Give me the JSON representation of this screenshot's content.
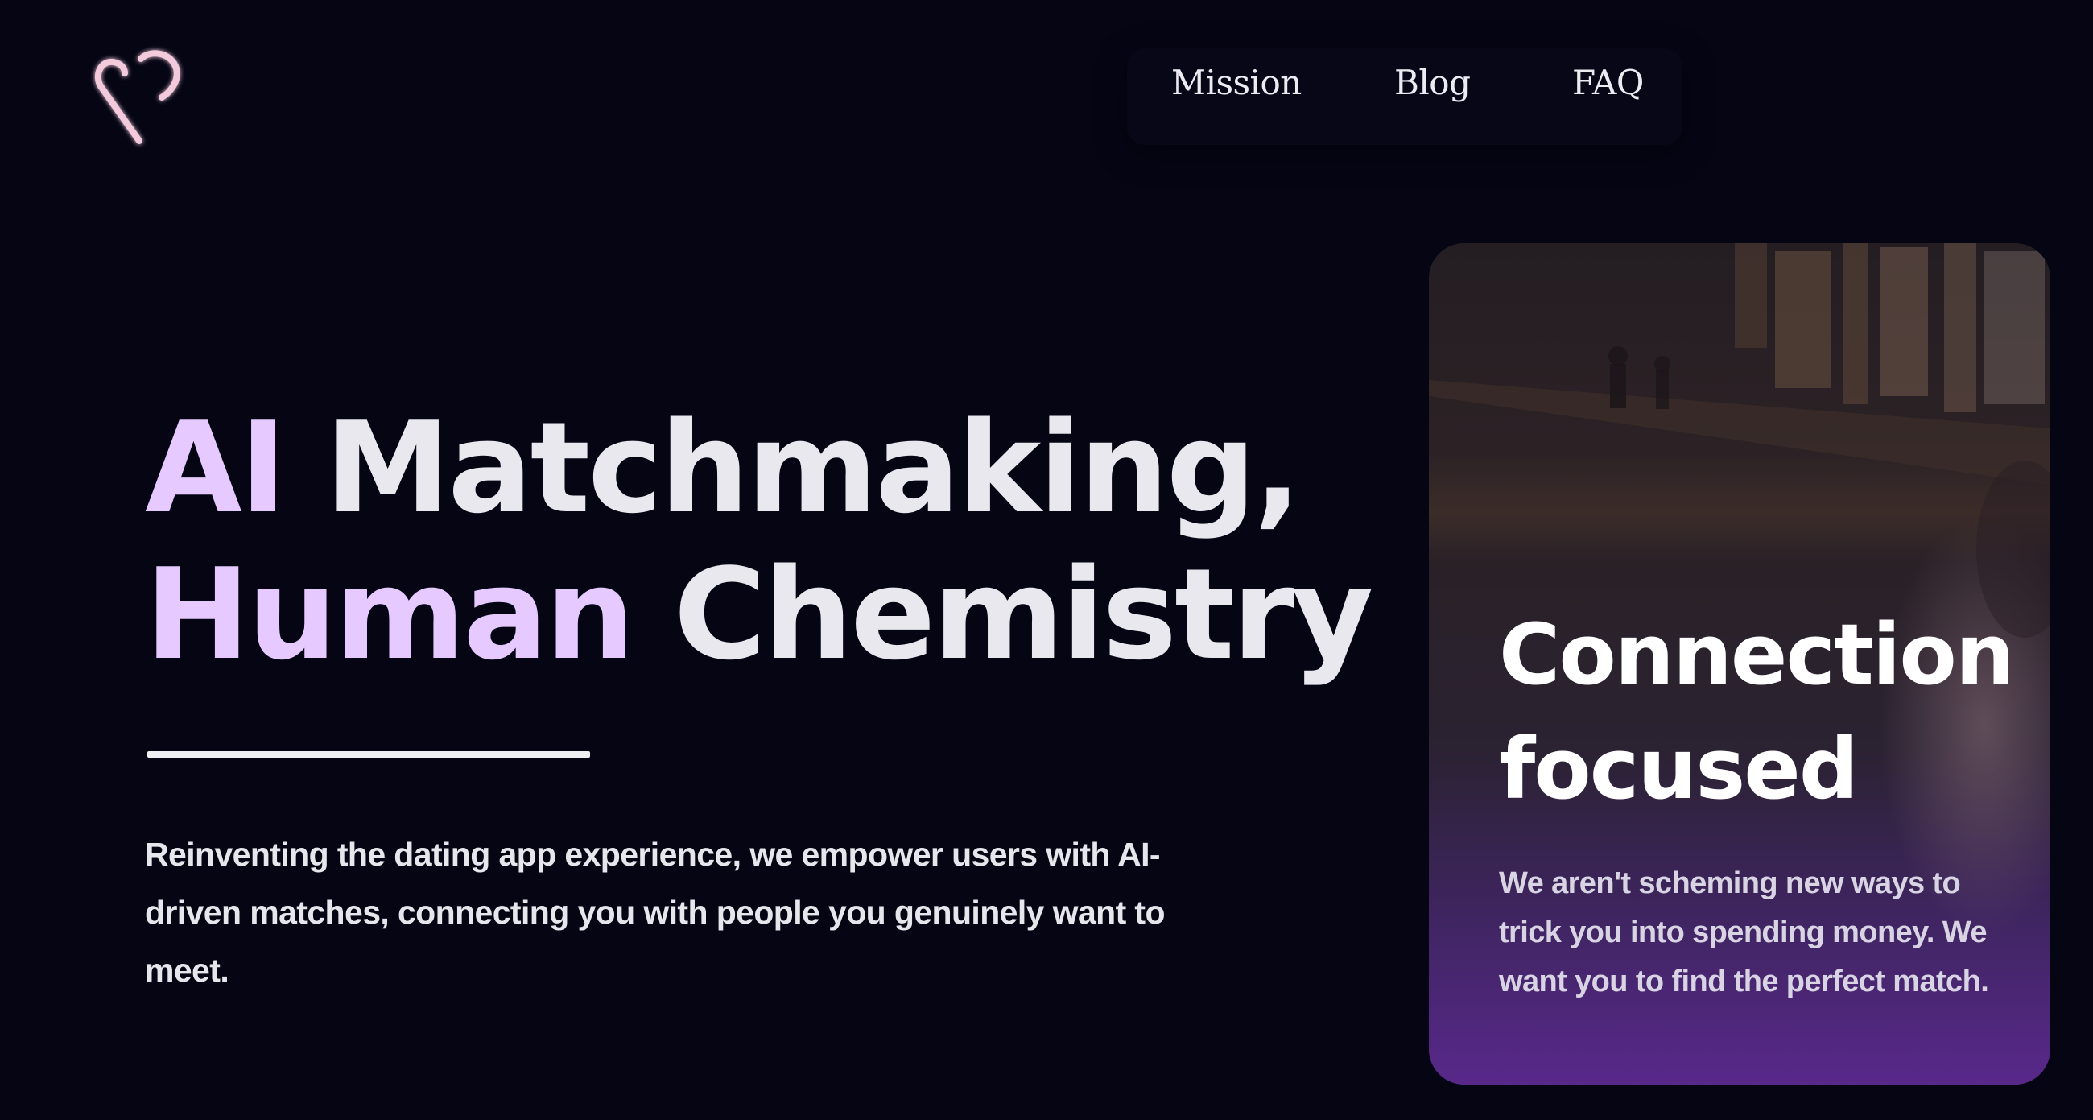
{
  "header": {
    "logo_icon": "heart-outline-icon",
    "nav": {
      "mission_label": "Mission",
      "blog_label": "Blog",
      "faq_label": "FAQ"
    }
  },
  "hero": {
    "title_line1_accent": "AI",
    "title_line1_rest": " Matchmaking,",
    "title_line2_accent": "Human",
    "title_line2_rest": " Chemistry",
    "subtitle": "Reinventing the dating app experience, we empower users with AI-driven matches, connecting you with people you genuinely want to meet."
  },
  "card": {
    "title_line1": "Connection",
    "title_line2": "focused",
    "text": "We aren't scheming new ways to trick you into spending money. We want you to find the perfect match."
  },
  "colors": {
    "background": "#050514",
    "accent": "#e5c9ff",
    "text": "#e8e8ee",
    "card_gradient_end": "#5a2a82",
    "logo_stroke": "#f3c9dc"
  }
}
